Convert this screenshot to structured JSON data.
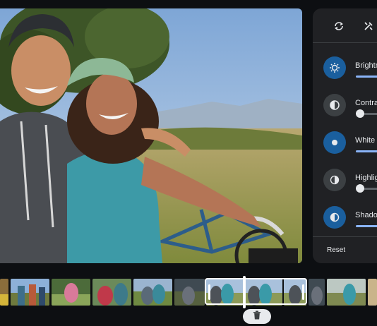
{
  "panel": {
    "tabs": [
      {
        "icon": "crop-rotate-icon"
      },
      {
        "icon": "tools-icon"
      }
    ],
    "adjustments": [
      {
        "label": "Brightness",
        "icon": "brightness-icon",
        "active": true,
        "level": 0.5
      },
      {
        "label": "Contrast",
        "icon": "contrast-icon",
        "active": false,
        "level": 0.0
      },
      {
        "label": "White point",
        "icon": "white-point-icon",
        "active": true,
        "level": 0.5
      },
      {
        "label": "Highlights",
        "icon": "highlights-icon",
        "active": false,
        "level": 0.0
      },
      {
        "label": "Shadows",
        "icon": "shadows-icon",
        "active": true,
        "level": 0.5
      }
    ],
    "reset_label": "Reset"
  },
  "filmstrip": {
    "delete_icon": "trash-icon"
  },
  "colors": {
    "accent": "#1a5f9e",
    "slider_active": "#8ab4f8",
    "panel_bg": "#202124"
  }
}
